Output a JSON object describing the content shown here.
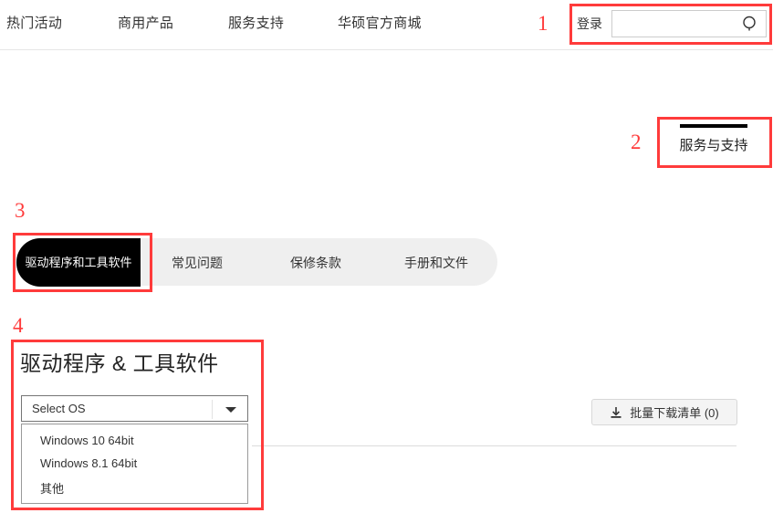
{
  "top_nav": {
    "links": [
      {
        "label": "热门活动"
      },
      {
        "label": "商用产品"
      },
      {
        "label": "服务支持"
      },
      {
        "label": "华硕官方商城"
      }
    ],
    "login_label": "登录",
    "search": {
      "value": "",
      "placeholder": "",
      "icon": "search-icon"
    }
  },
  "service_support": {
    "label": "服务与支持"
  },
  "tabs": {
    "active": {
      "label": "驱动程序和工具软件"
    },
    "items": [
      {
        "label": "常见问题"
      },
      {
        "label": "保修条款"
      },
      {
        "label": "手册和文件"
      }
    ]
  },
  "drivers": {
    "title": "驱动程序 & 工具软件",
    "os_select": {
      "selected": "Select OS",
      "arrow_icon": "chevron-down-icon",
      "options": [
        {
          "label": "Windows 10 64bit"
        },
        {
          "label": "Windows 8.1 64bit"
        },
        {
          "label": "其他"
        }
      ]
    },
    "batch_download": {
      "label": "批量下载清单 (0)",
      "icon": "download-icon"
    }
  },
  "annotations": {
    "color": "#ff3b3b",
    "markers": [
      {
        "number": "1"
      },
      {
        "number": "2"
      },
      {
        "number": "3"
      },
      {
        "number": "4"
      }
    ]
  }
}
